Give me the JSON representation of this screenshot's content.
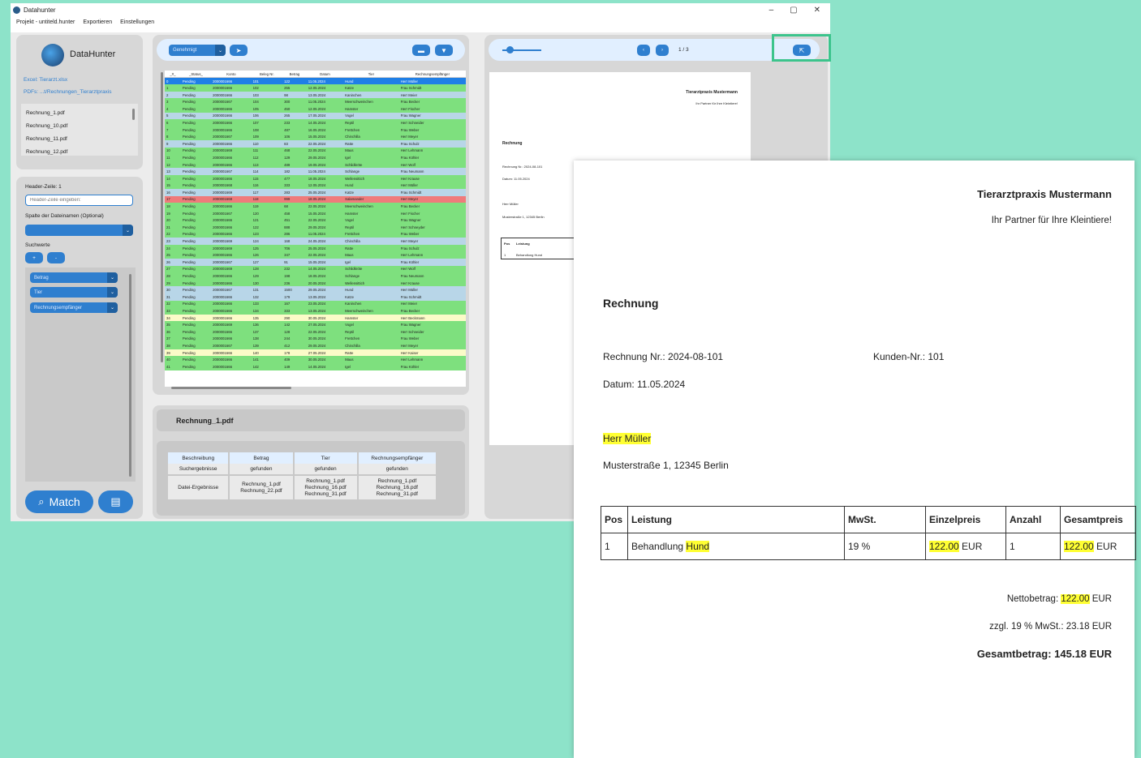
{
  "window": {
    "title": "Datahunter"
  },
  "menu": {
    "project": "Projekt - untiteld.hunter",
    "export": "Exportieren",
    "settings": "Einstellungen"
  },
  "sidebar": {
    "app_name": "DataHunter",
    "excel": "Excel: Tierarzt.xlsx",
    "pdfs": "PDFs: ...t/Rechnungen_Tierarztpraxis",
    "files": [
      "Rechnung_1.pdf",
      "Rechnung_10.pdf",
      "Rechnung_11.pdf",
      "Rechnung_12.pdf"
    ],
    "header_row_label": "Header-Zeile: 1",
    "header_row_placeholder": "Header-Zeile eingeben:",
    "filename_col_label": "Spalte der Dateinamen (Optional)",
    "search_values_label": "Suchwerte",
    "plus": "+",
    "minus": "-",
    "search_cols": [
      "Betrag",
      "Tier",
      "Rechnungsempfänger"
    ],
    "match_button": "Match"
  },
  "toolbar": {
    "status_filter": "Genehmigt",
    "page": "1 / 3"
  },
  "table": {
    "headers": [
      "_#_",
      "_Status_",
      "Konto",
      "Beleg Nr.",
      "Betrag",
      "Datum",
      "Tier",
      "Rechnungsempfänger"
    ],
    "rows": [
      [
        "0",
        "Pending",
        "2000001666",
        "101",
        "122",
        "11.05.2024",
        "Hund",
        "Herr Müller"
      ],
      [
        "1",
        "Pending",
        "2000001666",
        "102",
        "255",
        "12.05.2024",
        "Katze",
        "Frau Schmidt"
      ],
      [
        "2",
        "Pending",
        "2000001666",
        "103",
        "98",
        "13.05.2024",
        "Kaninchen",
        "Herr Meier"
      ],
      [
        "3",
        "Pending",
        "2000001667",
        "104",
        "300",
        "11.05.2024",
        "Meerschweinchen",
        "Frau Becker"
      ],
      [
        "4",
        "Pending",
        "2000001666",
        "105",
        "450",
        "12.05.2024",
        "Hamster",
        "Herr Fischer"
      ],
      [
        "5",
        "Pending",
        "2000001666",
        "106",
        "265",
        "17.05.2024",
        "Vogel",
        "Frau Wagner"
      ],
      [
        "6",
        "Pending",
        "2000001666",
        "107",
        "233",
        "14.05.2024",
        "Reptil",
        "Herr Schneider"
      ],
      [
        "7",
        "Pending",
        "2000001666",
        "108",
        "487",
        "16.05.2024",
        "Frettchen",
        "Frau Weber"
      ],
      [
        "8",
        "Pending",
        "2000001667",
        "109",
        "106",
        "15.05.2024",
        "Chinchilla",
        "Herr Meyer"
      ],
      [
        "9",
        "Pending",
        "2000001666",
        "110",
        "83",
        "22.05.2024",
        "Ratte",
        "Frau Schulz"
      ],
      [
        "10",
        "Pending",
        "2000001669",
        "111",
        "468",
        "22.05.2024",
        "Maus",
        "Herr Lehmann"
      ],
      [
        "11",
        "Pending",
        "2000001666",
        "112",
        "129",
        "29.05.2024",
        "Igel",
        "Frau Köhler"
      ],
      [
        "12",
        "Pending",
        "2000001666",
        "113",
        "489",
        "19.05.2024",
        "Schildkröte",
        "Herr Wolf"
      ],
      [
        "13",
        "Pending",
        "2000001667",
        "114",
        "182",
        "11.05.2024",
        "Schlange",
        "Frau Neumann"
      ],
      [
        "14",
        "Pending",
        "2000001666",
        "115",
        "477",
        "18.05.2024",
        "Wellensittich",
        "Herr Krause"
      ],
      [
        "15",
        "Pending",
        "2000001668",
        "116",
        "333",
        "12.05.2024",
        "Hund",
        "Herr Müller"
      ],
      [
        "16",
        "Pending",
        "2000001669",
        "117",
        "283",
        "25.05.2024",
        "Katze",
        "Frau Schmidt"
      ],
      [
        "17",
        "Pending",
        "2000001668",
        "118",
        "999",
        "18.05.2024",
        "Salamander",
        "Herr Meyer"
      ],
      [
        "18",
        "Pending",
        "2000001666",
        "119",
        "68",
        "22.05.2024",
        "Meerschweinchen",
        "Frau Becker"
      ],
      [
        "19",
        "Pending",
        "2000001667",
        "120",
        "458",
        "15.05.2024",
        "Hamster",
        "Herr Fischer"
      ],
      [
        "20",
        "Pending",
        "2000001666",
        "121",
        "451",
        "22.05.2024",
        "Vogel",
        "Frau Wagner"
      ],
      [
        "21",
        "Pending",
        "2000001666",
        "122",
        "888",
        "29.05.2024",
        "Reptil",
        "Herr Schneyder"
      ],
      [
        "22",
        "Pending",
        "2000001666",
        "123",
        "286",
        "11.05.2024",
        "Frettchen",
        "Frau Weber"
      ],
      [
        "23",
        "Pending",
        "2000001669",
        "124",
        "168",
        "24.05.2024",
        "Chinchilla",
        "Herr Meyer"
      ],
      [
        "24",
        "Pending",
        "2000001669",
        "125",
        "706",
        "25.05.2024",
        "Ratte",
        "Frau Schulz"
      ],
      [
        "25",
        "Pending",
        "2000001666",
        "126",
        "347",
        "22.05.2024",
        "Maus",
        "Herr Lehmann"
      ],
      [
        "26",
        "Pending",
        "2000001667",
        "127",
        "91",
        "15.05.2024",
        "Igel",
        "Frau Köhler"
      ],
      [
        "27",
        "Pending",
        "2000001669",
        "128",
        "232",
        "14.05.2024",
        "Schildkröte",
        "Herr Wolf"
      ],
      [
        "28",
        "Pending",
        "2000001666",
        "129",
        "198",
        "18.05.2024",
        "Schlange",
        "Frau Neumann"
      ],
      [
        "29",
        "Pending",
        "2000001666",
        "130",
        "236",
        "20.05.2024",
        "Wellensittich",
        "Herr Krause"
      ],
      [
        "30",
        "Pending",
        "2000001667",
        "131",
        "1500",
        "29.05.2024",
        "Hund",
        "Herr Müller"
      ],
      [
        "31",
        "Pending",
        "2000001666",
        "132",
        "179",
        "13.05.2024",
        "Katze",
        "Frau Schmidt"
      ],
      [
        "32",
        "Pending",
        "2000001666",
        "133",
        "167",
        "23.05.2024",
        "Kaninchen",
        "Herr Meier"
      ],
      [
        "33",
        "Pending",
        "2000001666",
        "134",
        "333",
        "13.05.2024",
        "Meerschweinchen",
        "Frau Becker"
      ],
      [
        "34",
        "Pending",
        "2000001666",
        "135",
        "290",
        "30.05.2024",
        "Hamster",
        "Herr Beckmann"
      ],
      [
        "35",
        "Pending",
        "2000001669",
        "136",
        "142",
        "27.05.2024",
        "Vogel",
        "Frau Wagner"
      ],
      [
        "36",
        "Pending",
        "2000001666",
        "137",
        "128",
        "22.05.2024",
        "Reptil",
        "Herr Schneider"
      ],
      [
        "37",
        "Pending",
        "2000001666",
        "138",
        "244",
        "30.05.2024",
        "Frettchen",
        "Frau Weber"
      ],
      [
        "38",
        "Pending",
        "2000001667",
        "139",
        "412",
        "29.05.2024",
        "Chinchilla",
        "Herr Meyer"
      ],
      [
        "39",
        "Pending",
        "2000001666",
        "140",
        "178",
        "27.05.2024",
        "Ratte",
        "Herr Kaiser"
      ],
      [
        "40",
        "Pending",
        "2000001666",
        "141",
        "409",
        "30.05.2024",
        "Maus",
        "Herr Lehmann"
      ],
      [
        "41",
        "Pending",
        "2000001666",
        "142",
        "149",
        "14.05.2024",
        "Igel",
        "Frau Köhler"
      ]
    ]
  },
  "result": {
    "file": "Rechnung_1.pdf",
    "headers": [
      "Beschreibung",
      "Betrag",
      "Tier",
      "Rechnungsempfänger"
    ],
    "search_label": "Suchergebnisse",
    "search": [
      "gefunden",
      "gefunden",
      "gefunden"
    ],
    "file_label": "Datei-Ergebnisse",
    "betrag_files": "Rechnung_1.pdf\nRechnung_22.pdf",
    "tier_files": "Rechnung_1.pdf\nRechnung_16.pdf\nRechnung_31.pdf",
    "empf_files": "Rechnung_1.pdf\nRechnung_16.pdf\nRechnung_31.pdf"
  },
  "invoice": {
    "company": "Tierarztpraxis Mustermann",
    "slogan": "Ihr Partner für Ihre Kleintiere!",
    "heading": "Rechnung",
    "number": "Rechnung Nr.: 2024-08-101",
    "customer": "Kunden-Nr.: 101",
    "date": "Datum: 11.05.2024",
    "name": "Herr Müller",
    "address": "Musterstraße 1, 12345 Berlin",
    "cols": [
      "Pos",
      "Leistung",
      "MwSt.",
      "Einzelpreis",
      "Anzahl",
      "Gesamtpreis"
    ],
    "pos": "1",
    "service_a": "Behandlung ",
    "service_b": "Hund",
    "vat": "19 %",
    "price_num": "122.00",
    "price_unit": " EUR",
    "qty": "1",
    "net_a": "Nettobetrag: ",
    "net_b": "122.00",
    "net_c": " EUR",
    "tax": "zzgl. 19 % MwSt.: 23.18 EUR",
    "total": "Gesamtbetrag: 145.18 EUR"
  },
  "colors": {
    "accent": "#2f7fcf",
    "highlight_box": "#3cc48c",
    "bg": "#8de3c9"
  }
}
